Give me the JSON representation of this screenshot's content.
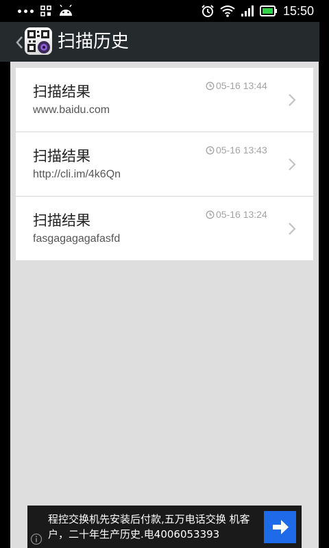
{
  "status_bar": {
    "time": "15:50",
    "icons": [
      "menu-dots-icon",
      "qr-grid-icon",
      "android-icon",
      "alarm-icon",
      "wifi-icon",
      "signal-icon",
      "battery-icon"
    ]
  },
  "action_bar": {
    "title": "扫描历史",
    "icons": [
      "back-icon",
      "qr-scanner-logo"
    ]
  },
  "history": [
    {
      "title": "扫描结果",
      "content": "www.baidu.com",
      "time": "05-16 13:44"
    },
    {
      "title": "扫描结果",
      "content": "http://cli.im/4k6Qn",
      "time": "05-16 13:43"
    },
    {
      "title": "扫描结果",
      "content": "fasgagagagafasfd",
      "time": "05-16 13:24"
    }
  ],
  "ad": {
    "text": "程控交换机先安装后付款,五万电话交换 机客户，二十年生产历史.电4006053393",
    "icons": [
      "arrow-right-icon",
      "info-icon"
    ],
    "accent": "#1e6ae8"
  },
  "colors": {
    "action_bar": "#252a2d",
    "content_bg": "#dedede"
  }
}
